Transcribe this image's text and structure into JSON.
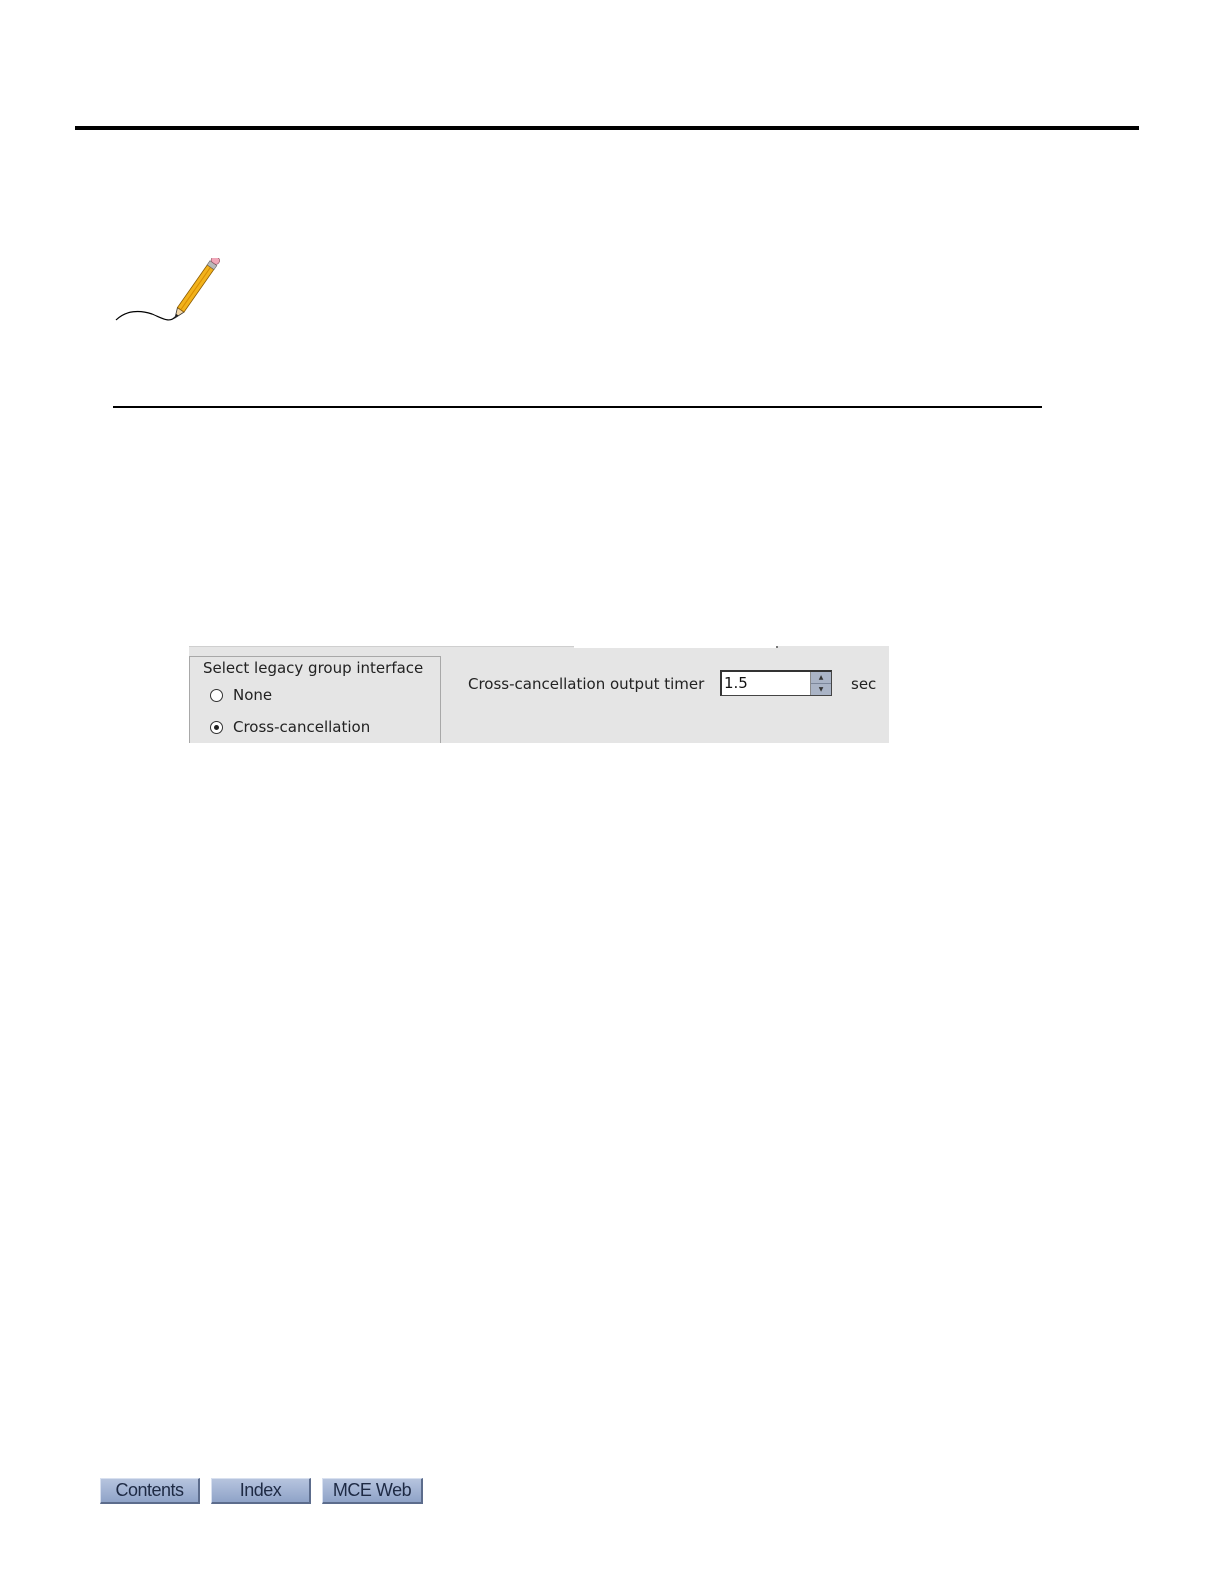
{
  "settings_panel": {
    "group_legend": "Select legacy group interface",
    "options": [
      {
        "label": "None",
        "selected": false
      },
      {
        "label": "Cross-cancellation",
        "selected": true
      }
    ],
    "timer_label": "Cross-cancellation output timer",
    "timer_value": "1.5",
    "timer_unit": "sec"
  },
  "icons": {
    "note": "pencil-icon",
    "spinner_up": "arrow-up-icon",
    "spinner_down": "arrow-down-icon"
  },
  "nav": {
    "buttons": [
      "Contents",
      "Index",
      "MCE Web"
    ]
  },
  "colors": {
    "panel_background": "#e5e5e5",
    "nav_button": "#9aadd0"
  }
}
